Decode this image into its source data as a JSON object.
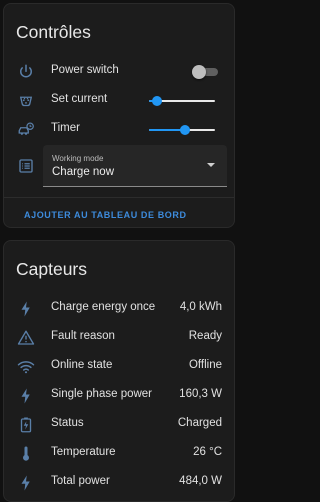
{
  "controls": {
    "title": "Contrôles",
    "power_switch": {
      "label": "Power switch",
      "on": false
    },
    "set_current": {
      "label": "Set current",
      "value_fraction": 0.12
    },
    "timer": {
      "label": "Timer",
      "value_fraction": 0.54
    },
    "working_mode": {
      "caption": "Working mode",
      "selected": "Charge now"
    },
    "add_to_dashboard": "AJOUTER AU TABLEAU DE BORD"
  },
  "sensors": {
    "title": "Capteurs",
    "items": [
      {
        "label": "Charge energy once",
        "value": "4,0 kWh",
        "icon": "flash-icon"
      },
      {
        "label": "Fault reason",
        "value": "Ready",
        "icon": "alert-triangle-icon"
      },
      {
        "label": "Online state",
        "value": "Offline",
        "icon": "wifi-icon"
      },
      {
        "label": "Single phase power",
        "value": "160,3 W",
        "icon": "flash-icon"
      },
      {
        "label": "Status",
        "value": "Charged",
        "icon": "battery-charging-icon"
      },
      {
        "label": "Temperature",
        "value": "26 °C",
        "icon": "thermometer-icon"
      },
      {
        "label": "Total power",
        "value": "484,0 W",
        "icon": "flash-icon"
      }
    ]
  },
  "colors": {
    "accent": "#2196f3",
    "link": "#3d8bdc",
    "icon": "#5a7fa8",
    "card": "#1c1c1c",
    "background": "#111111"
  }
}
